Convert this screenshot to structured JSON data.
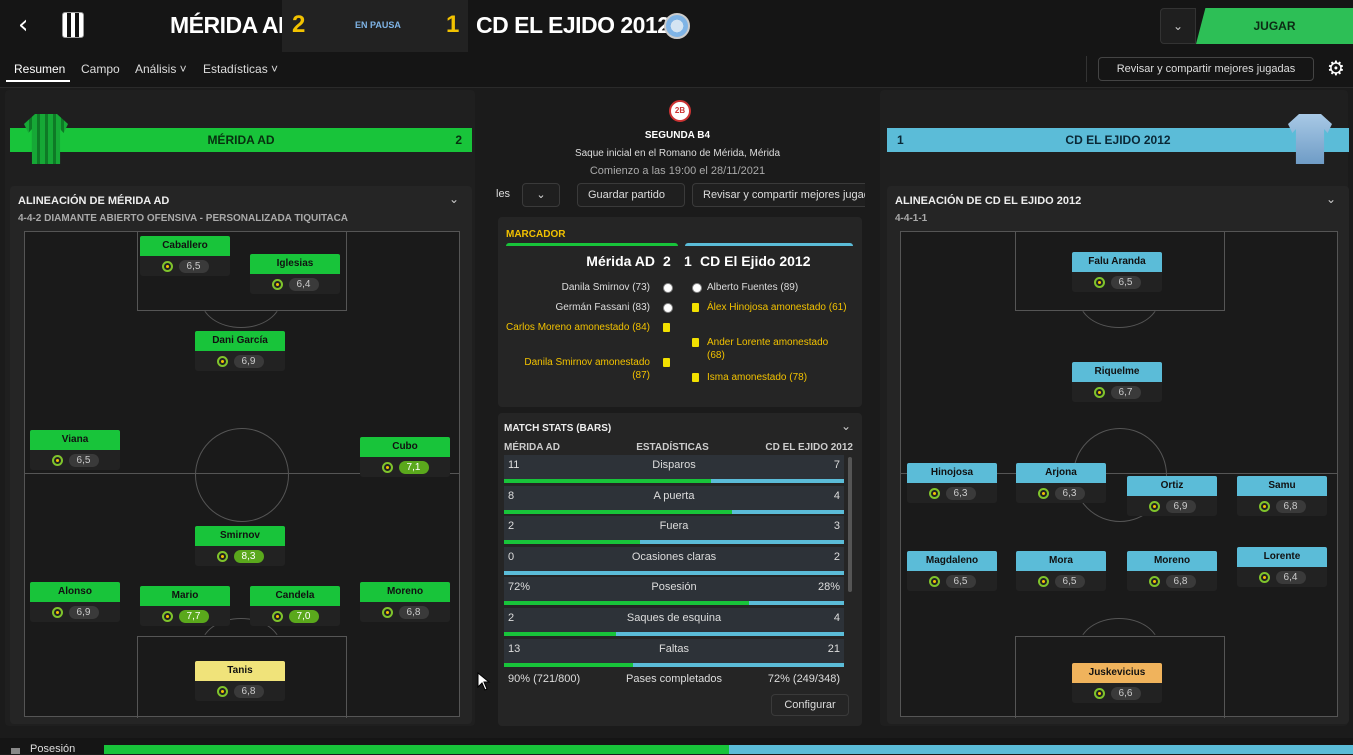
{
  "header": {
    "home_team": "MÉRIDA AD",
    "home_goals": "2",
    "status": "EN PAUSA",
    "away_goals": "1",
    "away_team": "CD EL EJIDO 2012",
    "play_label": "JUGAR",
    "back_icon": "back-arrow-icon",
    "dropdown_icon": "chevron-down-icon"
  },
  "nav": {
    "tabs": [
      "Resumen",
      "Campo",
      "Análisis ˅",
      "Estadísticas ˅"
    ],
    "share_label": "Revisar y compartir mejores jugadas",
    "settings_icon": "gear-icon"
  },
  "home": {
    "bar_name": "MÉRIDA AD",
    "bar_score": "2",
    "lineup_title": "ALINEACIÓN DE MÉRIDA AD",
    "formation": "4-4-2 DIAMANTE ABIERTO OFENSIVA - PERSONALIZADA TIQUITACA",
    "players": [
      {
        "name": "Caballero",
        "rating": "6,5"
      },
      {
        "name": "Iglesias",
        "rating": "6,4"
      },
      {
        "name": "Dani García",
        "rating": "6,9"
      },
      {
        "name": "Viana",
        "rating": "6,5"
      },
      {
        "name": "Cubo",
        "rating": "7,1"
      },
      {
        "name": "Smirnov",
        "rating": "8,3"
      },
      {
        "name": "Alonso",
        "rating": "6,9"
      },
      {
        "name": "Mario",
        "rating": "7,7"
      },
      {
        "name": "Candela",
        "rating": "7,0"
      },
      {
        "name": "Moreno",
        "rating": "6,8"
      },
      {
        "name": "Tanis",
        "rating": "6,8"
      }
    ]
  },
  "away": {
    "bar_name": "CD EL EJIDO 2012",
    "bar_score": "1",
    "lineup_title": "ALINEACIÓN DE CD EL EJIDO 2012",
    "formation": "4-4-1-1",
    "players": [
      {
        "name": "Falu Aranda",
        "rating": "6,5"
      },
      {
        "name": "Riquelme",
        "rating": "6,7"
      },
      {
        "name": "Hinojosa",
        "rating": "6,3"
      },
      {
        "name": "Arjona",
        "rating": "6,3"
      },
      {
        "name": "Ortiz",
        "rating": "6,9"
      },
      {
        "name": "Samu",
        "rating": "6,8"
      },
      {
        "name": "Magdaleno",
        "rating": "6,5"
      },
      {
        "name": "Mora",
        "rating": "6,5"
      },
      {
        "name": "Moreno",
        "rating": "6,8"
      },
      {
        "name": "Lorente",
        "rating": "6,4"
      },
      {
        "name": "Juskevicius",
        "rating": "6,6"
      }
    ]
  },
  "match": {
    "league_badge": "2B",
    "competition": "SEGUNDA B4",
    "kickoff": "Saque inicial en el Romano de Mérida, Mérida",
    "start_time": "Comienzo a las 19:00 el 28/11/2021",
    "btn_partial": "les",
    "btn_save": "Guardar partido",
    "btn_share": "Revisar y compartir mejores jugadas",
    "scoreboard_label": "MARCADOR",
    "sb_home": "Mérida AD",
    "sb_home_goals": "2",
    "sb_away_goals": "1",
    "sb_away": "CD El Ejido 2012",
    "home_events": [
      {
        "text": "Danila Smirnov (73)",
        "type": "goal"
      },
      {
        "text": "Germán Fassani (83)",
        "type": "goal"
      },
      {
        "text": "Carlos Moreno amonestado (84)",
        "type": "card"
      },
      {
        "text": "Danila Smirnov amonestado (87)",
        "type": "card"
      }
    ],
    "away_events": [
      {
        "text": "Alberto Fuentes (89)",
        "type": "goal"
      },
      {
        "text": "Álex Hinojosa amonestado (61)",
        "type": "card"
      },
      {
        "text": "Ander Lorente amonestado (68)",
        "type": "card"
      },
      {
        "text": "Isma amonestado (78)",
        "type": "card"
      }
    ],
    "stats_title": "MATCH STATS (BARS)",
    "stats_home": "MÉRIDA AD",
    "stats_center": "ESTADÍSTICAS",
    "stats_away": "CD EL EJIDO 2012",
    "stats": [
      {
        "label": "Disparos",
        "home": "11",
        "away": "7",
        "home_share": 0.61
      },
      {
        "label": "A puerta",
        "home": "8",
        "away": "4",
        "home_share": 0.67
      },
      {
        "label": "Fuera",
        "home": "2",
        "away": "3",
        "home_share": 0.4
      },
      {
        "label": "Ocasiones claras",
        "home": "0",
        "away": "2",
        "home_share": 0.0
      },
      {
        "label": "Posesión",
        "home": "72%",
        "away": "28%",
        "home_share": 0.72
      },
      {
        "label": "Saques de esquina",
        "home": "2",
        "away": "4",
        "home_share": 0.33
      },
      {
        "label": "Faltas",
        "home": "13",
        "away": "21",
        "home_share": 0.38
      },
      {
        "label": "Pases completados",
        "home": "90% (721/800)",
        "away": "72% (249/348)",
        "home_share": 0.5
      }
    ],
    "configure_label": "Configurar"
  },
  "bottom": {
    "possession_label": "Posesión",
    "home_possession": 0.5
  }
}
